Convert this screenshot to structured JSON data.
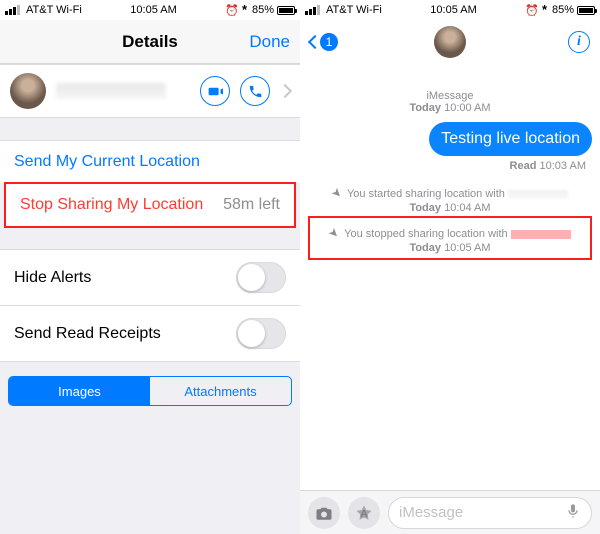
{
  "statusbar": {
    "carrier": "AT&T Wi-Fi",
    "time": "10:05 AM",
    "battery_pct": "85%"
  },
  "details": {
    "title": "Details",
    "done": "Done",
    "send_location": "Send My Current Location",
    "stop_sharing": "Stop Sharing My Location",
    "time_left": "58m left",
    "hide_alerts": "Hide Alerts",
    "read_receipts": "Send Read Receipts",
    "seg_images": "Images",
    "seg_attachments": "Attachments"
  },
  "messages": {
    "back_count": "1",
    "app_label": "iMessage",
    "day": "Today",
    "header_time": "10:00 AM",
    "bubble_text": "Testing live location",
    "read_label": "Read",
    "read_time": "10:03 AM",
    "sys_started": "You started sharing location with",
    "sys_started_time": "10:04 AM",
    "sys_stopped": "You stopped sharing location with",
    "sys_stopped_time": "10:05 AM",
    "input_placeholder": "iMessage"
  }
}
